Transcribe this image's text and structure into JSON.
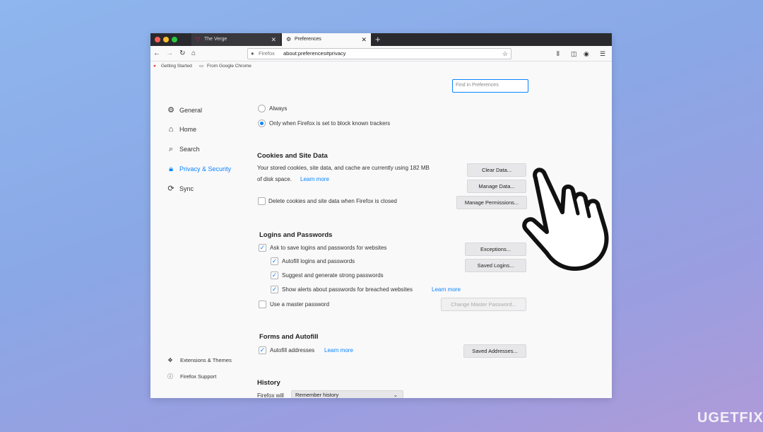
{
  "tabs": [
    {
      "label": "The Verge",
      "icon": "verge-icon"
    },
    {
      "label": "Preferences",
      "icon": "gear-icon"
    }
  ],
  "navbar": {
    "url_label": "Firefox",
    "url": "about:preferences#privacy"
  },
  "bookmarks": [
    "Getting Started",
    "From Google Chrome"
  ],
  "search": {
    "placeholder": "Find in Preferences"
  },
  "sidebar": {
    "items": [
      {
        "label": "General",
        "icon": "gear-icon"
      },
      {
        "label": "Home",
        "icon": "home-icon"
      },
      {
        "label": "Search",
        "icon": "search-icon"
      },
      {
        "label": "Privacy & Security",
        "icon": "lock-icon",
        "active": true
      },
      {
        "label": "Sync",
        "icon": "sync-icon"
      }
    ],
    "footer": [
      {
        "label": "Extensions & Themes",
        "icon": "puzzle-icon"
      },
      {
        "label": "Firefox Support",
        "icon": "help-icon"
      }
    ]
  },
  "tracking": {
    "always": "Always",
    "only_when": "Only when Firefox is set to block known trackers"
  },
  "cookies": {
    "title": "Cookies and Site Data",
    "desc1": "Your stored cookies, site data, and cache are currently using 182 MB",
    "desc2": "of disk space.",
    "learn_more": "Learn more",
    "delete_label": "Delete cookies and site data when Firefox is closed",
    "clear_btn": "Clear Data...",
    "manage_btn": "Manage Data...",
    "permissions_btn": "Manage Permissions..."
  },
  "logins": {
    "title": "Logins and Passwords",
    "ask_save": "Ask to save logins and passwords for websites",
    "autofill": "Autofill logins and passwords",
    "suggest": "Suggest and generate strong passwords",
    "alerts": "Show alerts about passwords for breached websites",
    "learn_more": "Learn more",
    "master": "Use a master password",
    "exceptions_btn": "Exceptions...",
    "saved_btn": "Saved Logins...",
    "change_master_btn": "Change Master Password..."
  },
  "forms": {
    "title": "Forms and Autofill",
    "autofill_addresses": "Autofill addresses",
    "learn_more": "Learn more",
    "saved_addresses_btn": "Saved Addresses..."
  },
  "history": {
    "title": "History",
    "firefox_will": "Firefox will",
    "select_value": "Remember history"
  },
  "watermark": "UGETFIX",
  "colors": {
    "accent": "#0a84ff"
  }
}
